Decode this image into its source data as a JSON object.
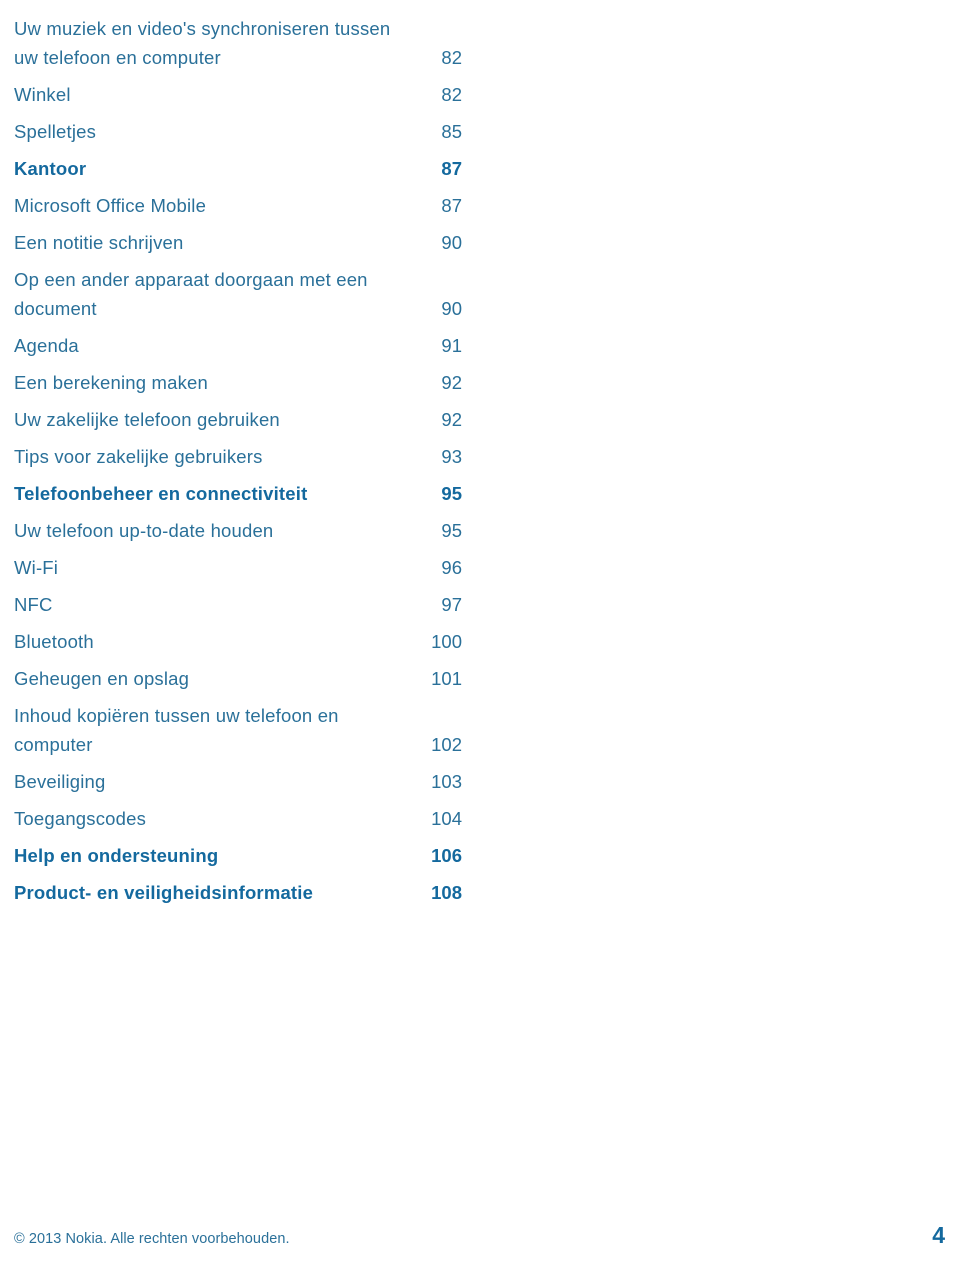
{
  "document": {
    "type": "table-of-contents",
    "language": "nl"
  },
  "toc": {
    "entries": [
      {
        "title": "Uw muziek en video's synchroniseren tussen uw telefoon en computer",
        "page": "82",
        "level": 2,
        "wrapped": true
      },
      {
        "title": "Winkel",
        "page": "82",
        "level": 2,
        "wrapped": false
      },
      {
        "title": "Spelletjes",
        "page": "85",
        "level": 2,
        "wrapped": false
      },
      {
        "title": "Kantoor",
        "page": "87",
        "level": 1,
        "wrapped": false
      },
      {
        "title": "Microsoft Office Mobile",
        "page": "87",
        "level": 2,
        "wrapped": false
      },
      {
        "title": "Een notitie schrijven",
        "page": "90",
        "level": 2,
        "wrapped": false
      },
      {
        "title": "Op een ander apparaat doorgaan met een document",
        "page": "90",
        "level": 2,
        "wrapped": true
      },
      {
        "title": "Agenda",
        "page": "91",
        "level": 2,
        "wrapped": false
      },
      {
        "title": "Een berekening maken",
        "page": "92",
        "level": 2,
        "wrapped": false
      },
      {
        "title": "Uw zakelijke telefoon gebruiken",
        "page": "92",
        "level": 2,
        "wrapped": false
      },
      {
        "title": "Tips voor zakelijke gebruikers",
        "page": "93",
        "level": 2,
        "wrapped": false
      },
      {
        "title": "Telefoonbeheer en connectiviteit",
        "page": "95",
        "level": 1,
        "wrapped": false
      },
      {
        "title": "Uw telefoon up-to-date houden",
        "page": "95",
        "level": 2,
        "wrapped": false
      },
      {
        "title": "Wi-Fi",
        "page": "96",
        "level": 2,
        "wrapped": false
      },
      {
        "title": "NFC",
        "page": "97",
        "level": 2,
        "wrapped": false
      },
      {
        "title": "Bluetooth",
        "page": "100",
        "level": 2,
        "wrapped": false
      },
      {
        "title": "Geheugen en opslag",
        "page": "101",
        "level": 2,
        "wrapped": false
      },
      {
        "title": "Inhoud kopiëren tussen uw telefoon en computer",
        "page": "102",
        "level": 2,
        "wrapped": true
      },
      {
        "title": "Beveiliging",
        "page": "103",
        "level": 2,
        "wrapped": false
      },
      {
        "title": "Toegangscodes",
        "page": "104",
        "level": 2,
        "wrapped": false
      },
      {
        "title": "Help en ondersteuning",
        "page": "106",
        "level": 1,
        "wrapped": false
      },
      {
        "title": "Product- en veiligheidsinformatie",
        "page": "108",
        "level": 1,
        "wrapped": false
      }
    ]
  },
  "footer": {
    "copyright": "© 2013 Nokia. Alle rechten voorbehouden.",
    "page_number": "4"
  },
  "colors": {
    "text_regular": "#2a7099",
    "text_bold": "#14699e",
    "background": "#ffffff"
  }
}
